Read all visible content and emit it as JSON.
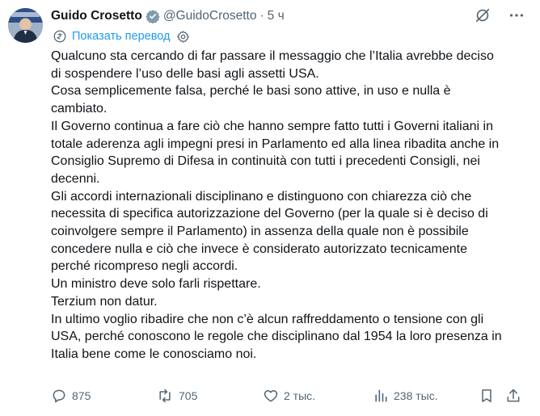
{
  "post": {
    "author_name": "Guido Crosetto",
    "handle": "@GuidoCrosetto",
    "separator": "·",
    "time": "5 ч",
    "translate_label": "Показать перевод",
    "text_lines": [
      "Qualcuno sta cercando di far passare il messaggio che l’Italia avrebbe deciso",
      "di sospendere l’uso delle basi agli assetti USA.",
      "Cosa semplicemente falsa, perché le basi sono attive, in uso e nulla è",
      "cambiato.",
      "Il Governo continua a fare ciò che hanno sempre fatto tutti i Governi italiani in",
      "totale aderenza agli impegni presi in Parlamento ed alla linea ribadita anche in",
      "Consiglio Supremo di Difesa in continuità con tutti i precedenti Consigli, nei",
      "decenni.",
      "Gli accordi internazionali disciplinano e distinguono con chiarezza ciò che",
      "necessita di specifica autorizzazione del Governo (per la quale si è deciso di",
      "coinvolgere sempre il Parlamento) in assenza della quale non è possibile",
      "concedere nulla e ciò che invece è considerato autorizzato tecnicamente",
      "perché ricompreso negli accordi.",
      "Un ministro deve solo farli rispettare.",
      "Terzium non datur.",
      "In ultimo voglio ribadire che non c’è alcun raffreddamento o tensione con gli",
      "USA, perché conoscono le regole che disciplinano dal 1954 la loro presenza in",
      "Italia bene come le conosciamo noi."
    ]
  },
  "stats": {
    "replies": "875",
    "reposts": "705",
    "likes": "2 тыс.",
    "views": "238 тыс."
  },
  "icons": {
    "verified": "verified-badge-icon",
    "grok": "grok-icon",
    "more": "more-options-icon",
    "translate": "translate-icon",
    "settings": "settings-gear-icon",
    "reply": "reply-icon",
    "repost": "repost-icon",
    "like": "heart-icon",
    "views": "views-chart-icon",
    "bookmark": "bookmark-icon",
    "share": "share-icon"
  },
  "colors": {
    "text": "#0f1419",
    "secondary": "#536471",
    "accent": "#1d9bf0"
  }
}
